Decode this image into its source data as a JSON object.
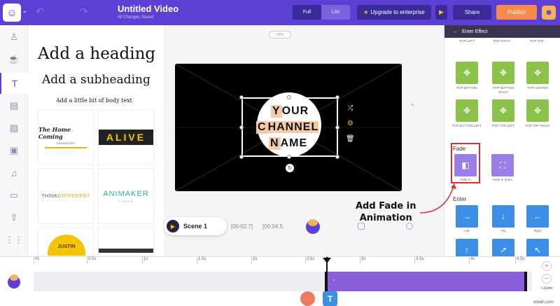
{
  "header": {
    "title": "Untitled Video",
    "subtitle": "All Changes Saved",
    "toggle_full": "Full",
    "toggle_lite": "Lite",
    "upgrade_label": "Upgrade to enterprise",
    "share_label": "Share",
    "publish_label": "Publish"
  },
  "text_panel": {
    "heading": "Add a heading",
    "subheading": "Add a subheading",
    "body": "Add a little bit of body text",
    "templates": {
      "home_coming": "The Home Coming",
      "home_coming_sub": "#TRUESTORY",
      "alive": "ALIVE",
      "think_a": "THINK/",
      "think_b": "DIFFERENT",
      "animaker": "ANIMAKER",
      "animaker_sub": "TIMES",
      "justin": "JUSTIN"
    }
  },
  "workspace": {
    "zoom": "75%",
    "stage_text": [
      "YOUR",
      "CHANNEL",
      "NAME"
    ],
    "stage_initials": [
      "Y",
      "C",
      "N"
    ],
    "stage_rest": [
      "OUR",
      "HANNEL",
      "AME"
    ],
    "scene_label": "Scene 1",
    "time_current": "[00:02.7]",
    "time_total": "[00:04.5"
  },
  "callout": {
    "line1": "Add Fade in",
    "line2": "Animation"
  },
  "effects": {
    "panel_title": "Enter Effect",
    "pop_top_labels": [
      "POP LEFT",
      "POP RIGHT",
      "POP TOP"
    ],
    "pop_row1": [
      "POP BOTTOM",
      "POP BOTTOM RIGHT",
      "POP CENTER"
    ],
    "pop_row2": [
      "POP BOTTOM LEFT",
      "POP TOP LEFT",
      "POP TOP RIGHT"
    ],
    "fade_section": "Fade",
    "fade_items": [
      "Fade In",
      "Fade In Zoom"
    ],
    "enter_section": "Enter",
    "enter_items": [
      "Left",
      "Top",
      "Right"
    ]
  },
  "timeline": {
    "ticks": [
      "0s",
      "0.5s",
      "1s",
      "1.5s",
      "2s",
      "2.5s",
      "3s",
      "3.5s",
      "4s",
      "4.5s"
    ],
    "zoom_label": "Zoom"
  },
  "colors": {
    "brand": "#5d3fd3",
    "publish": "#f7894a",
    "effect_green": "#8bc34a",
    "effect_purple": "#9b7de6",
    "effect_blue": "#3b8fe6",
    "highlight": "#d9322e",
    "clip": "#8a5fdc"
  },
  "watermark": "wtxdn.com"
}
